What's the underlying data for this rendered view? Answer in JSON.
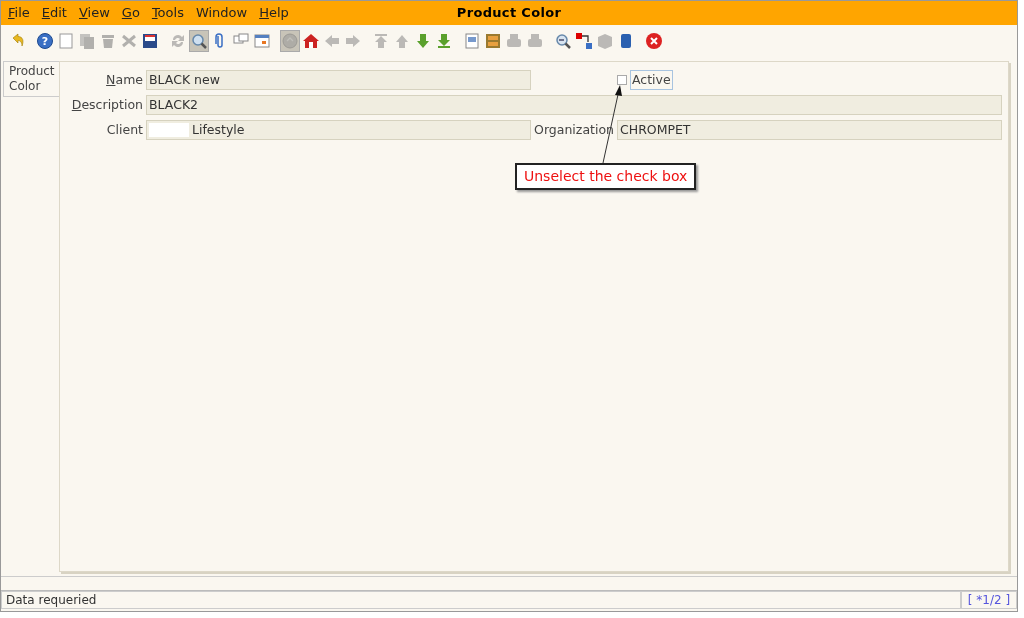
{
  "menu": [
    {
      "label": "File",
      "mnemonic": true
    },
    {
      "label": "Edit",
      "mnemonic": true
    },
    {
      "label": "View",
      "mnemonic": true
    },
    {
      "label": "Go",
      "mnemonic": true
    },
    {
      "label": "Tools",
      "mnemonic": true
    },
    {
      "label": "Window",
      "mnemonic": false
    },
    {
      "label": "Help",
      "mnemonic": true
    }
  ],
  "window": {
    "title": "Product Color"
  },
  "toolbar": [
    {
      "kind": "undo",
      "disabled": false,
      "pressed": false
    },
    {
      "kind": "gap"
    },
    {
      "kind": "help",
      "glyph": "?",
      "disabled": false,
      "pressed": false
    },
    {
      "kind": "new",
      "disabled": false,
      "pressed": false
    },
    {
      "kind": "copy",
      "disabled": true,
      "pressed": false
    },
    {
      "kind": "delete",
      "disabled": true,
      "pressed": false
    },
    {
      "kind": "cross",
      "disabled": true,
      "pressed": false
    },
    {
      "kind": "save",
      "disabled": false,
      "pressed": false
    },
    {
      "kind": "gap"
    },
    {
      "kind": "refresh",
      "disabled": true,
      "pressed": false
    },
    {
      "kind": "find",
      "disabled": false,
      "pressed": true
    },
    {
      "kind": "attach",
      "disabled": false,
      "pressed": false
    },
    {
      "kind": "chat",
      "disabled": false,
      "pressed": false
    },
    {
      "kind": "calendar",
      "disabled": false,
      "pressed": false
    },
    {
      "kind": "gap"
    },
    {
      "kind": "history",
      "disabled": true,
      "pressed": true
    },
    {
      "kind": "home",
      "disabled": false,
      "pressed": false
    },
    {
      "kind": "left",
      "disabled": true,
      "pressed": false
    },
    {
      "kind": "right",
      "disabled": true,
      "pressed": false
    },
    {
      "kind": "gap"
    },
    {
      "kind": "first",
      "disabled": true,
      "pressed": false
    },
    {
      "kind": "up",
      "disabled": true,
      "pressed": false
    },
    {
      "kind": "down",
      "disabled": false,
      "pressed": false
    },
    {
      "kind": "last",
      "disabled": false,
      "pressed": false
    },
    {
      "kind": "gap"
    },
    {
      "kind": "report",
      "disabled": false,
      "pressed": false
    },
    {
      "kind": "archive",
      "disabled": false,
      "pressed": false
    },
    {
      "kind": "print",
      "disabled": true,
      "pressed": false
    },
    {
      "kind": "print",
      "disabled": true,
      "pressed": false
    },
    {
      "kind": "gap"
    },
    {
      "kind": "zoom",
      "disabled": false,
      "pressed": false
    },
    {
      "kind": "workflow",
      "disabled": false,
      "pressed": false
    },
    {
      "kind": "product",
      "disabled": true,
      "pressed": false
    },
    {
      "kind": "info",
      "disabled": false,
      "pressed": false
    },
    {
      "kind": "gap"
    },
    {
      "kind": "close",
      "disabled": false,
      "pressed": false
    }
  ],
  "tabs": [
    {
      "label": "Product Color",
      "selected": true
    }
  ],
  "form": {
    "name": {
      "label": "Name",
      "mnemonic": true,
      "value": "BLACK new"
    },
    "active": {
      "label": "Active",
      "checked": false
    },
    "description": {
      "label": "Description",
      "mnemonic": true,
      "value": "BLACK2"
    },
    "client": {
      "label": "Client",
      "value": "Lifestyle",
      "redacted": true
    },
    "organization": {
      "label": "Organization",
      "value": "CHROMPET"
    }
  },
  "annotation": {
    "text": "Unselect the check box"
  },
  "status_bar": {
    "message": "Data requeried",
    "record": "[ *1/2 ]"
  }
}
